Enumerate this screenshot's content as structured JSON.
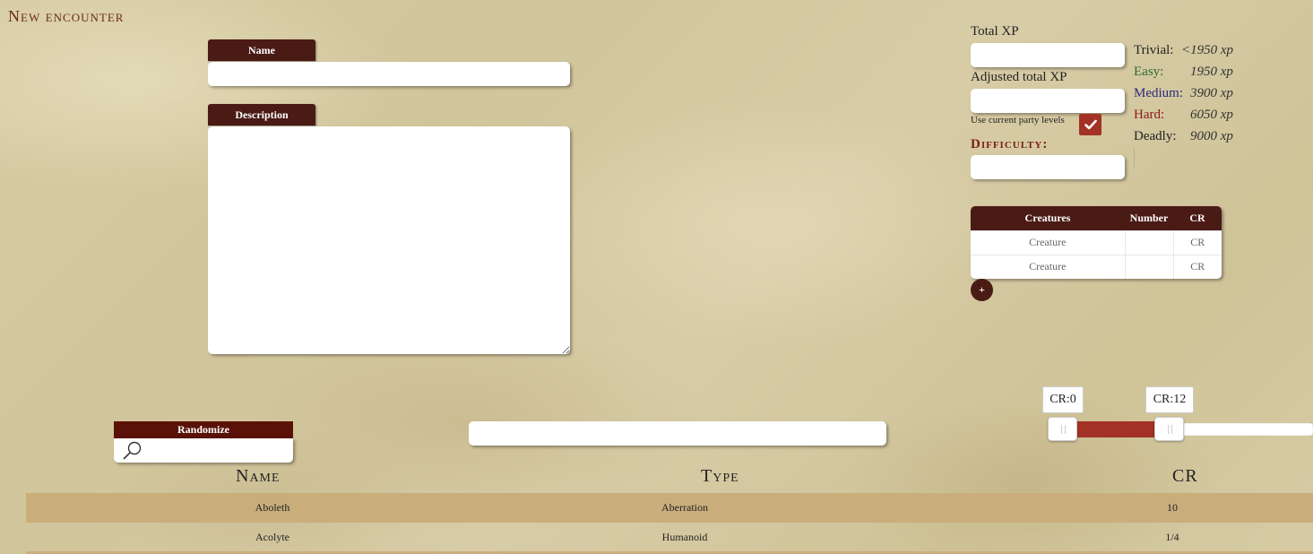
{
  "page": {
    "title": "New encounter"
  },
  "form": {
    "name_label": "Name",
    "name_value": "",
    "description_label": "Description",
    "description_value": ""
  },
  "xp": {
    "total_label": "Total XP",
    "total_value": "",
    "adjusted_label": "Adjusted total XP",
    "adjusted_value": "",
    "party_levels_label": "Use current party levels",
    "party_levels_checked": true,
    "difficulty_label": "Difficulty:",
    "difficulty_value": ""
  },
  "thresholds": [
    {
      "label": "Trivial:",
      "value": "<1950 xp",
      "color": "#222222"
    },
    {
      "label": "Easy:",
      "value": "1950 xp",
      "color": "#2e6b2e"
    },
    {
      "label": "Medium:",
      "value": "3900 xp",
      "color": "#2a2a7a"
    },
    {
      "label": "Hard:",
      "value": "6050 xp",
      "color": "#8b1a1a"
    },
    {
      "label": "Deadly:",
      "value": "9000 xp",
      "color": "#222222"
    }
  ],
  "creatures_table": {
    "headers": [
      "Creatures",
      "Number",
      "CR"
    ],
    "rows": [
      {
        "creature": "Creature",
        "number": "",
        "cr": "CR"
      },
      {
        "creature": "Creature",
        "number": "",
        "cr": "CR"
      }
    ],
    "add_label": "+"
  },
  "search": {
    "randomize_label": "Randomize",
    "query": "",
    "type_filter": ""
  },
  "cr_filter": {
    "min_label": "CR:0",
    "max_label": "CR:12",
    "min_fraction": 0.0,
    "max_fraction": 0.36
  },
  "results": {
    "headers": [
      "Name",
      "Type",
      "CR"
    ],
    "rows": [
      {
        "name": "Aboleth",
        "type": "Aberration",
        "cr": "10"
      },
      {
        "name": "Acolyte",
        "type": "Humanoid",
        "cr": "1/4"
      }
    ]
  },
  "colors": {
    "accent": "#4a1a15",
    "range": "#a33125",
    "alt_row": "#c9ae7c",
    "title": "#6b2a1f"
  }
}
